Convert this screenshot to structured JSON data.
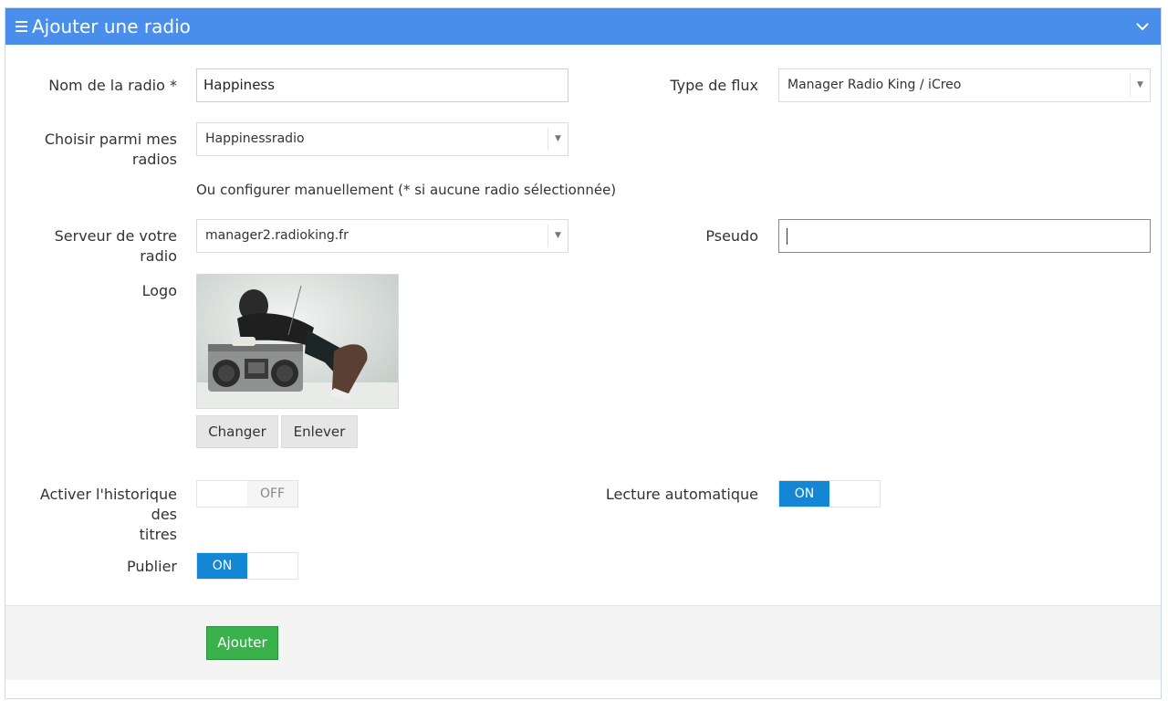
{
  "header": {
    "title": "Ajouter une radio",
    "menu_icon": "hamburger-icon",
    "collapse_icon": "chevron-down-icon",
    "color": "#4a8eec"
  },
  "form": {
    "radio_name": {
      "label": "Nom de la radio *",
      "value": "Happiness"
    },
    "stream_type": {
      "label": "Type de flux",
      "value": "Manager Radio King / iCreo"
    },
    "choose_radio": {
      "label_line1": "Choisir parmi mes",
      "label_line2": "radios",
      "value": "Happinessradio"
    },
    "manual_hint": "Ou configurer manuellement (* si aucune radio sélectionnée)",
    "server": {
      "label": "Serveur de votre radio",
      "value": "manager2.radioking.fr"
    },
    "pseudo": {
      "label": "Pseudo",
      "value": ""
    },
    "logo": {
      "label": "Logo",
      "change_label": "Changer",
      "remove_label": "Enlever"
    },
    "history": {
      "label_line1": "Activer l'historique des",
      "label_line2": "titres",
      "state": "OFF"
    },
    "autoplay": {
      "label": "Lecture automatique",
      "state": "ON"
    },
    "publish": {
      "label": "Publier",
      "state": "ON"
    }
  },
  "footer": {
    "submit_label": "Ajouter",
    "submit_color": "#3ab24b"
  },
  "colors": {
    "toggle_on": "#1387d6"
  }
}
